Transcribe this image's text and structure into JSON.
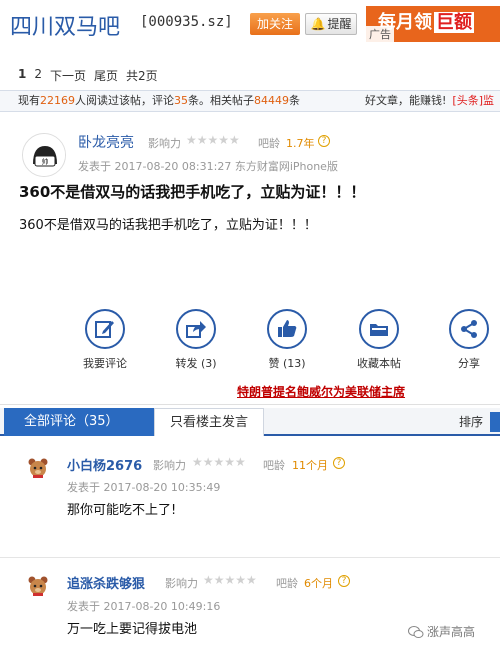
{
  "header": {
    "forum_title": "四川双马吧",
    "stock_code": "[000935.sz]",
    "follow_label": "加关注",
    "remind_label": "提醒",
    "ad_text_a": "每月领",
    "ad_text_b": "巨额",
    "ad_tag": "广告"
  },
  "pager": {
    "pages": [
      "1",
      "2"
    ],
    "next_label": "下一页",
    "last_label": "尾页",
    "total_label": "共2页"
  },
  "stats": {
    "prefix": "现有",
    "readers": "22169",
    "readers_suffix": "人阅读过该帖，评论",
    "comments": "35",
    "comments_suffix": "条。相关帖子",
    "related": "84449",
    "related_suffix": "条",
    "share_text": "好文章，能赚钱!",
    "hot_text": "[头条]监"
  },
  "post": {
    "author": "卧龙亮亮",
    "influence_label": "影响力",
    "stars": "★★★★★",
    "age_label": "吧龄",
    "age_value": "1.7年",
    "meta": "发表于  2017-08-20 08:31:27  东方财富网iPhone版",
    "title": "360不是借双马的话我把手机吃了，立贴为证！！！",
    "body": "360不是借双马的话我把手机吃了，立贴为证！！！",
    "news_link": "特朗普提名鲍威尔为美联储主席"
  },
  "actions": [
    {
      "label": "我要评论",
      "icon": "edit-icon"
    },
    {
      "label": "转发 (3)",
      "icon": "share-forward-icon"
    },
    {
      "label": "赞 (13)",
      "icon": "thumbs-up-icon"
    },
    {
      "label": "收藏本帖",
      "icon": "folder-icon"
    },
    {
      "label": "分享",
      "icon": "share-nodes-icon"
    }
  ],
  "tabs": {
    "all_label": "全部评论（35）",
    "owner_label": "只看楼主发言",
    "sort_label": "排序"
  },
  "comments": [
    {
      "author": "小白杨2676",
      "influence_label": "影响力",
      "stars": "★★★★★",
      "age_label": "吧龄",
      "age_value": "11个月",
      "meta": "发表于  2017-08-20 10:35:49",
      "body": "那你可能吃不上了!"
    },
    {
      "author": "追涨杀跌够狠",
      "influence_label": "影响力",
      "stars": "★★★★★",
      "age_label": "吧龄",
      "age_value": "6个月",
      "meta": "发表于  2017-08-20 10:49:16",
      "body": "万一吃上要记得拔电池"
    }
  ],
  "watermark": "涨声高高"
}
